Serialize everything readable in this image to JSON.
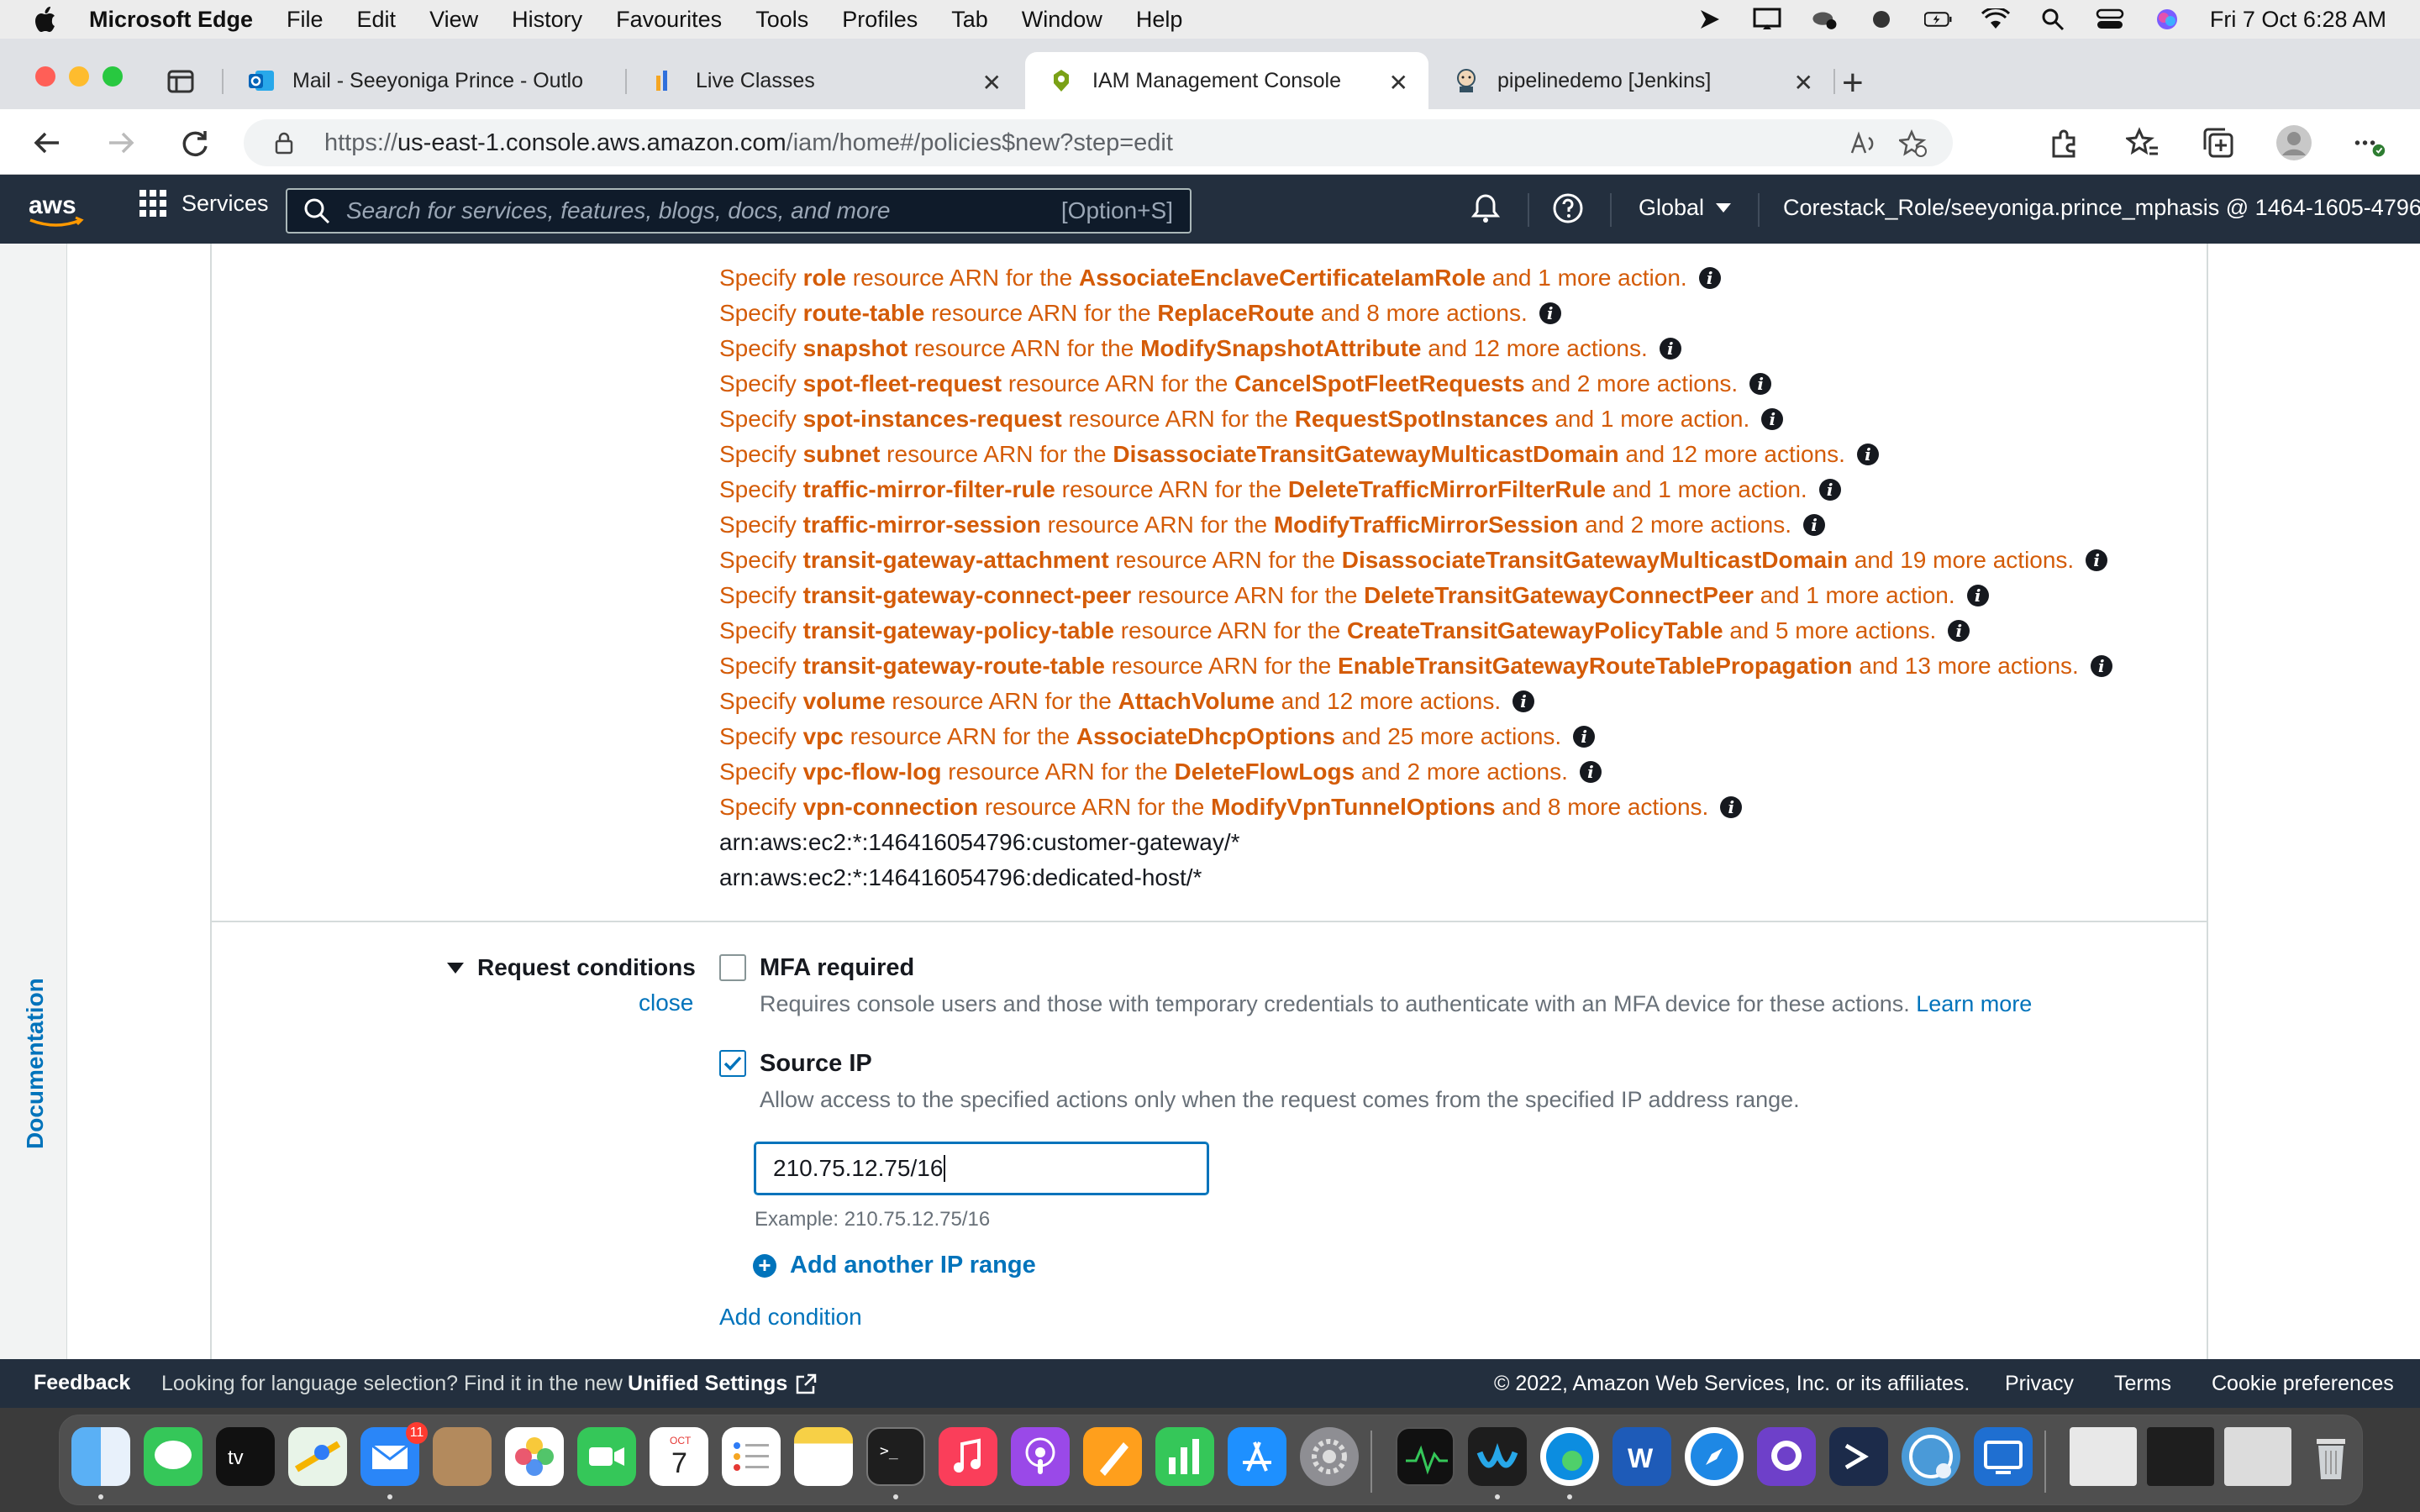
{
  "menubar": {
    "app": "Microsoft Edge",
    "items": [
      "File",
      "Edit",
      "View",
      "History",
      "Favourites",
      "Tools",
      "Profiles",
      "Tab",
      "Window",
      "Help"
    ],
    "clock": "Fri 7 Oct  6:28 AM"
  },
  "tabs": [
    {
      "title": "Mail - Seeyoniga Prince - Outlo",
      "icon": "outlook-icon"
    },
    {
      "title": "Live Classes",
      "icon": "chart-bars-icon"
    },
    {
      "title": "IAM Management Console",
      "icon": "aws-iam-icon"
    },
    {
      "title": "pipelinedemo [Jenkins]",
      "icon": "jenkins-icon"
    }
  ],
  "address": {
    "scheme": "https://",
    "host": "us-east-1.console.aws.amazon.com",
    "path": "/iam/home#/policies$new?step=edit"
  },
  "aws_header": {
    "logo_text": "aws",
    "services_label": "Services",
    "search_placeholder": "Search for services, features, blogs, docs, and more",
    "search_shortcut": "[Option+S]",
    "region": "Global",
    "account": "Corestack_Role/seeyoniga.prince_mphasis @ 1464-1605-4796"
  },
  "documentation_label": "Documentation",
  "warnings": [
    {
      "resource": "role",
      "action": "AssociateEnclaveCertificateIamRole",
      "more": "and 1 more action."
    },
    {
      "resource": "route-table",
      "action": "ReplaceRoute",
      "more": "and 8 more actions."
    },
    {
      "resource": "snapshot",
      "action": "ModifySnapshotAttribute",
      "more": "and 12 more actions."
    },
    {
      "resource": "spot-fleet-request",
      "action": "CancelSpotFleetRequests",
      "more": "and 2 more actions."
    },
    {
      "resource": "spot-instances-request",
      "action": "RequestSpotInstances",
      "more": "and 1 more action."
    },
    {
      "resource": "subnet",
      "action": "DisassociateTransitGatewayMulticastDomain",
      "more": "and 12 more actions."
    },
    {
      "resource": "traffic-mirror-filter-rule",
      "action": "DeleteTrafficMirrorFilterRule",
      "more": "and 1 more action."
    },
    {
      "resource": "traffic-mirror-session",
      "action": "ModifyTrafficMirrorSession",
      "more": "and 2 more actions."
    },
    {
      "resource": "transit-gateway-attachment",
      "action": "DisassociateTransitGatewayMulticastDomain",
      "more": "and 19 more actions."
    },
    {
      "resource": "transit-gateway-connect-peer",
      "action": "DeleteTransitGatewayConnectPeer",
      "more": "and 1 more action."
    },
    {
      "resource": "transit-gateway-policy-table",
      "action": "CreateTransitGatewayPolicyTable",
      "more": "and 5 more actions."
    },
    {
      "resource": "transit-gateway-route-table",
      "action": "EnableTransitGatewayRouteTablePropagation",
      "more": "and 13 more actions."
    },
    {
      "resource": "volume",
      "action": "AttachVolume",
      "more": "and 12 more actions."
    },
    {
      "resource": "vpc",
      "action": "AssociateDhcpOptions",
      "more": "and 25 more actions."
    },
    {
      "resource": "vpc-flow-log",
      "action": "DeleteFlowLogs",
      "more": "and 2 more actions."
    },
    {
      "resource": "vpn-connection",
      "action": "ModifyVpnTunnelOptions",
      "more": "and 8 more actions."
    }
  ],
  "warning_words": {
    "specify": "Specify",
    "mid": "resource ARN for the"
  },
  "arns": [
    "arn:aws:ec2:*:146416054796:customer-gateway/*",
    "arn:aws:ec2:*:146416054796:dedicated-host/*"
  ],
  "request_conditions": {
    "title": "Request conditions",
    "close": "close",
    "mfa": {
      "label": "MFA required",
      "checked": false,
      "description": "Requires console users and those with temporary credentials to authenticate with an MFA device for these actions.",
      "learn_more": "Learn more"
    },
    "source_ip": {
      "label": "Source IP",
      "checked": true,
      "description": "Allow access to the specified actions only when the request comes from the specified IP address range.",
      "value": "210.75.12.75/16",
      "example": "Example: 210.75.12.75/16"
    },
    "add_ip": "Add another IP range",
    "add_condition": "Add condition"
  },
  "footer": {
    "feedback": "Feedback",
    "language_prompt": "Looking for language selection? Find it in the new",
    "unified_settings": "Unified Settings",
    "copyright": "© 2022, Amazon Web Services, Inc. or its affiliates.",
    "privacy": "Privacy",
    "terms": "Terms",
    "cookies": "Cookie preferences"
  },
  "dock": {
    "mail_badge": "11",
    "calendar_month": "OCT",
    "calendar_day": "7"
  }
}
